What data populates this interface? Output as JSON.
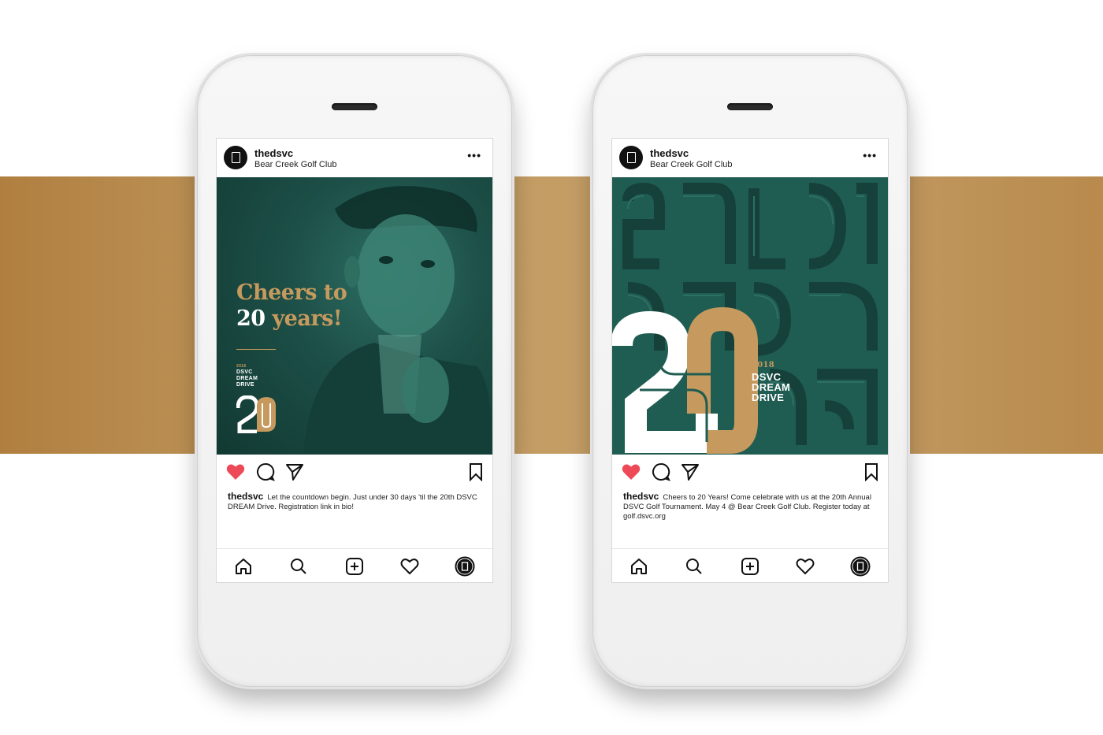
{
  "posts": [
    {
      "username": "thedsvc",
      "location": "Bear Creek Golf Club",
      "more_label": "•••",
      "headline_line1": "Cheers to",
      "headline_line2_num": "20",
      "headline_line2_rest": "years!",
      "event_year": "2018",
      "event_lines": [
        "DSVC",
        "DREAM",
        "DRIVE"
      ],
      "caption_user": "thedsvc",
      "caption_text": "Let the countdown begin. Just under 30 days 'til the 20th DSVC DREAM Drive. Registration link in bio!"
    },
    {
      "username": "thedsvc",
      "location": "Bear Creek Golf Club",
      "more_label": "•••",
      "event_year": "2018",
      "event_lines": [
        "DSVC",
        "DREAM",
        "DRIVE"
      ],
      "caption_user": "thedsvc",
      "caption_text": "Cheers to 20 Years! Come celebrate with us at the 20th Annual DSVC Golf Tournament. May 4 @ Bear Creek Golf Club. Register today at golf.dsvc.org"
    }
  ],
  "icons": {
    "actions": [
      "heart-filled-icon",
      "comment-icon",
      "share-icon",
      "bookmark-icon"
    ],
    "tabbar": [
      "home-icon",
      "search-icon",
      "add-post-icon",
      "activity-heart-icon",
      "profile-avatar-icon"
    ]
  },
  "colors": {
    "band": "#c29a60",
    "post_green": "#1f5c52",
    "gold": "#c69a5e",
    "like_red": "#ed4956"
  }
}
